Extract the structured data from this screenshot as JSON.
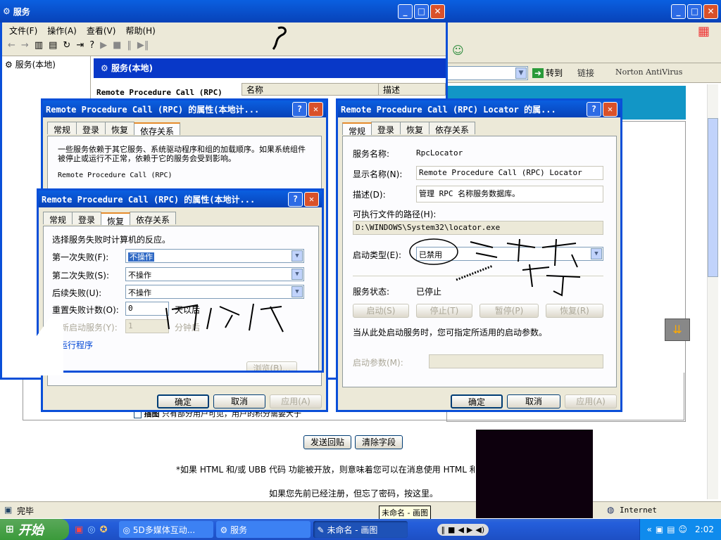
{
  "services_window": {
    "title": "服务",
    "menu": [
      "文件(F)",
      "操作(A)",
      "查看(V)",
      "帮助(H)"
    ],
    "tree_root": "服务(本地)",
    "pane_title": "服务(本地)",
    "selected_service": "Remote Procedure Call (RPC)",
    "col_name": "名称",
    "col_desc": "描述"
  },
  "browser": {
    "go_label": "转到",
    "links_label": "链接",
    "norton_label": "Norton AntiVirus",
    "send_reply": "发送回贴",
    "clear_fields": "清除字段",
    "html_note": "*如果 HTML 和/或 UBB 代码 功能被开放，则意味着您可以在消息使用 HTML 和.",
    "register_note": "如果您先前已经注册，但忘了密码，按这里。",
    "status_done": "完毕",
    "zone": "Internet",
    "attach_label": "插图",
    "attach_note": "只有部分用户可见，用户的积分需要大于"
  },
  "dialog_deps": {
    "title": "Remote Procedure Call (RPC) 的属性(本地计...",
    "tabs": [
      "常规",
      "登录",
      "恢复",
      "依存关系"
    ],
    "description": "一些服务依赖于其它服务、系统驱动程序和组的加载顺序。如果系统组件被停止或运行不正常，依赖于它的服务会受到影响。",
    "service_item": "Remote Procedure Call (RPC)",
    "ok": "确定",
    "cancel": "取消",
    "apply": "应用(A)"
  },
  "dialog_recovery": {
    "title": "Remote Procedure Call (RPC) 的属性(本地计...",
    "tabs": [
      "常规",
      "登录",
      "恢复",
      "依存关系"
    ],
    "intro": "选择服务失败时计算机的反应。",
    "first_failure_label": "第一次失败(F):",
    "first_failure_value": "不操作",
    "second_failure_label": "第二次失败(S):",
    "second_failure_value": "不操作",
    "subsequent_label": "后续失败(U):",
    "subsequent_value": "不操作",
    "reset_label": "重置失败计数(O):",
    "reset_value": "0",
    "reset_unit": "天以后",
    "restart_label": "重新启动服务(Y):",
    "restart_value": "1",
    "restart_unit": "分钟后",
    "run_program_group": "运行程序",
    "browse": "浏览(B)..."
  },
  "dialog_locator": {
    "title": "Remote Procedure Call (RPC) Locator 的属...",
    "tabs": [
      "常规",
      "登录",
      "恢复",
      "依存关系"
    ],
    "service_name_label": "服务名称:",
    "service_name": "RpcLocator",
    "display_name_label": "显示名称(N):",
    "display_name": "Remote Procedure Call (RPC) Locator",
    "description_label": "描述(D):",
    "description": "管理 RPC 名称服务数据库。",
    "exe_path_label": "可执行文件的路径(H):",
    "exe_path": "D:\\WINDOWS\\System32\\locator.exe",
    "startup_type_label": "启动类型(E):",
    "startup_type": "已禁用",
    "status_label": "服务状态:",
    "status": "已停止",
    "start": "启动(S)",
    "stop": "停止(T)",
    "pause": "暂停(P)",
    "resume": "恢复(R)",
    "start_params_note": "当从此处启动服务时，您可指定所适用的启动参数。",
    "start_params_label": "启动参数(M):",
    "ok": "确定",
    "cancel": "取消",
    "apply": "应用(A)"
  },
  "taskbar": {
    "start": "开始",
    "tasks": [
      "5D多媒体互动...",
      "服务",
      "未命名 - 画图"
    ],
    "tooltip": "未命名 - 画图",
    "clock": "2:02"
  },
  "colors": {
    "title_blue": "#0a5fe0",
    "taskbar_blue": "#245edb",
    "start_green": "#3a9a3a"
  }
}
